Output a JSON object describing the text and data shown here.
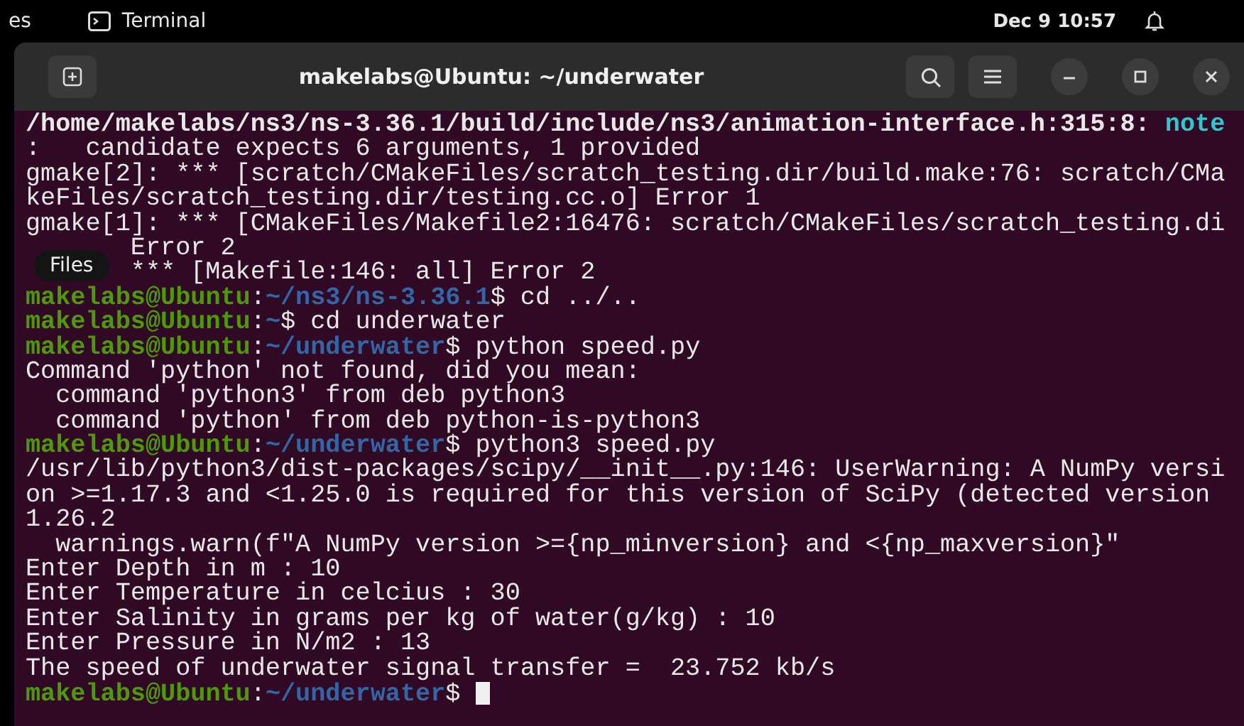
{
  "top_bar": {
    "activities": "es",
    "app_name": "Terminal",
    "clock": "Dec 9  10:57"
  },
  "window": {
    "title": "makelabs@Ubuntu: ~/underwater"
  },
  "tooltip": {
    "text": "Files"
  },
  "lines": [
    {
      "kind": "diagnostic",
      "location": "/home/makelabs/ns3/ns-3.36.1/build/include/ns3/animation-interface.h:315:8: ",
      "severity": "note"
    },
    {
      "kind": "text",
      "text": ":   candidate expects 6 arguments, 1 provided"
    },
    {
      "kind": "text",
      "text": "gmake[2]: *** [scratch/CMakeFiles/scratch_testing.dir/build.make:76: scratch/CMa"
    },
    {
      "kind": "text",
      "text": "keFiles/scratch_testing.dir/testing.cc.o] Error 1"
    },
    {
      "kind": "text",
      "text": "gmake[1]: *** [CMakeFiles/Makefile2:16476: scratch/CMakeFiles/scratch_testing.di"
    },
    {
      "kind": "covered_text",
      "text": "Error 2"
    },
    {
      "kind": "covered_text",
      "text": "*** [Makefile:146: all] Error 2"
    },
    {
      "kind": "prompt",
      "user": "makelabs@Ubuntu",
      "separator": ":",
      "path": "~/ns3/ns-3.36.1",
      "symbol": "$",
      "command": " cd ../..",
      "cursor": false
    },
    {
      "kind": "prompt",
      "user": "makelabs@Ubuntu",
      "separator": ":",
      "path": "~",
      "symbol": "$",
      "command": " cd underwater",
      "cursor": false
    },
    {
      "kind": "prompt",
      "user": "makelabs@Ubuntu",
      "separator": ":",
      "path": "~/underwater",
      "symbol": "$",
      "command": " python speed.py",
      "cursor": false
    },
    {
      "kind": "text",
      "text": "Command 'python' not found, did you mean:"
    },
    {
      "kind": "text",
      "text": "  command 'python3' from deb python3"
    },
    {
      "kind": "text",
      "text": "  command 'python' from deb python-is-python3"
    },
    {
      "kind": "prompt",
      "user": "makelabs@Ubuntu",
      "separator": ":",
      "path": "~/underwater",
      "symbol": "$",
      "command": " python3 speed.py",
      "cursor": false
    },
    {
      "kind": "text",
      "text": "/usr/lib/python3/dist-packages/scipy/__init__.py:146: UserWarning: A NumPy versi"
    },
    {
      "kind": "text",
      "text": "on >=1.17.3 and <1.25.0 is required for this version of SciPy (detected version"
    },
    {
      "kind": "text",
      "text": "1.26.2"
    },
    {
      "kind": "text",
      "text": "  warnings.warn(f\"A NumPy version >={np_minversion} and <{np_maxversion}\""
    },
    {
      "kind": "text",
      "text": "Enter Depth in m : 10"
    },
    {
      "kind": "text",
      "text": "Enter Temperature in celcius : 30"
    },
    {
      "kind": "text",
      "text": "Enter Salinity in grams per kg of water(g/kg) : 10"
    },
    {
      "kind": "text",
      "text": "Enter Pressure in N/m2 : 13"
    },
    {
      "kind": "text",
      "text": "The speed of underwater signal transfer =  23.752 kb/s"
    },
    {
      "kind": "prompt",
      "user": "makelabs@Ubuntu",
      "separator": ":",
      "path": "~/underwater",
      "symbol": "$",
      "cursor": true
    }
  ]
}
